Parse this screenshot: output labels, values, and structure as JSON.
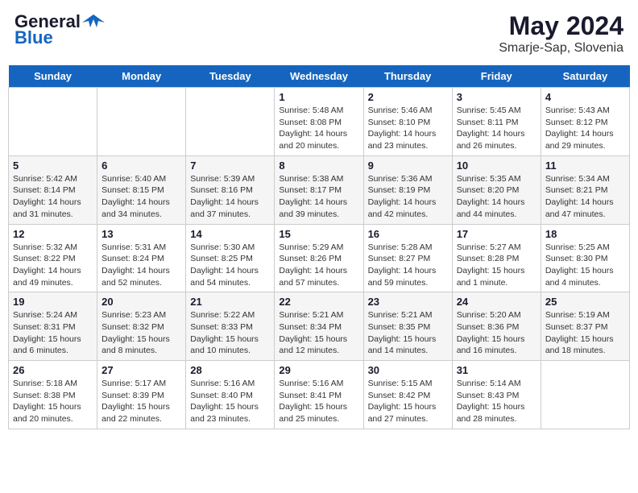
{
  "header": {
    "logo_line1": "General",
    "logo_line2": "Blue",
    "month": "May 2024",
    "location": "Smarje-Sap, Slovenia"
  },
  "days_of_week": [
    "Sunday",
    "Monday",
    "Tuesday",
    "Wednesday",
    "Thursday",
    "Friday",
    "Saturday"
  ],
  "weeks": [
    [
      {
        "day": "",
        "info": ""
      },
      {
        "day": "",
        "info": ""
      },
      {
        "day": "",
        "info": ""
      },
      {
        "day": "1",
        "info": "Sunrise: 5:48 AM\nSunset: 8:08 PM\nDaylight: 14 hours\nand 20 minutes."
      },
      {
        "day": "2",
        "info": "Sunrise: 5:46 AM\nSunset: 8:10 PM\nDaylight: 14 hours\nand 23 minutes."
      },
      {
        "day": "3",
        "info": "Sunrise: 5:45 AM\nSunset: 8:11 PM\nDaylight: 14 hours\nand 26 minutes."
      },
      {
        "day": "4",
        "info": "Sunrise: 5:43 AM\nSunset: 8:12 PM\nDaylight: 14 hours\nand 29 minutes."
      }
    ],
    [
      {
        "day": "5",
        "info": "Sunrise: 5:42 AM\nSunset: 8:14 PM\nDaylight: 14 hours\nand 31 minutes."
      },
      {
        "day": "6",
        "info": "Sunrise: 5:40 AM\nSunset: 8:15 PM\nDaylight: 14 hours\nand 34 minutes."
      },
      {
        "day": "7",
        "info": "Sunrise: 5:39 AM\nSunset: 8:16 PM\nDaylight: 14 hours\nand 37 minutes."
      },
      {
        "day": "8",
        "info": "Sunrise: 5:38 AM\nSunset: 8:17 PM\nDaylight: 14 hours\nand 39 minutes."
      },
      {
        "day": "9",
        "info": "Sunrise: 5:36 AM\nSunset: 8:19 PM\nDaylight: 14 hours\nand 42 minutes."
      },
      {
        "day": "10",
        "info": "Sunrise: 5:35 AM\nSunset: 8:20 PM\nDaylight: 14 hours\nand 44 minutes."
      },
      {
        "day": "11",
        "info": "Sunrise: 5:34 AM\nSunset: 8:21 PM\nDaylight: 14 hours\nand 47 minutes."
      }
    ],
    [
      {
        "day": "12",
        "info": "Sunrise: 5:32 AM\nSunset: 8:22 PM\nDaylight: 14 hours\nand 49 minutes."
      },
      {
        "day": "13",
        "info": "Sunrise: 5:31 AM\nSunset: 8:24 PM\nDaylight: 14 hours\nand 52 minutes."
      },
      {
        "day": "14",
        "info": "Sunrise: 5:30 AM\nSunset: 8:25 PM\nDaylight: 14 hours\nand 54 minutes."
      },
      {
        "day": "15",
        "info": "Sunrise: 5:29 AM\nSunset: 8:26 PM\nDaylight: 14 hours\nand 57 minutes."
      },
      {
        "day": "16",
        "info": "Sunrise: 5:28 AM\nSunset: 8:27 PM\nDaylight: 14 hours\nand 59 minutes."
      },
      {
        "day": "17",
        "info": "Sunrise: 5:27 AM\nSunset: 8:28 PM\nDaylight: 15 hours\nand 1 minute."
      },
      {
        "day": "18",
        "info": "Sunrise: 5:25 AM\nSunset: 8:30 PM\nDaylight: 15 hours\nand 4 minutes."
      }
    ],
    [
      {
        "day": "19",
        "info": "Sunrise: 5:24 AM\nSunset: 8:31 PM\nDaylight: 15 hours\nand 6 minutes."
      },
      {
        "day": "20",
        "info": "Sunrise: 5:23 AM\nSunset: 8:32 PM\nDaylight: 15 hours\nand 8 minutes."
      },
      {
        "day": "21",
        "info": "Sunrise: 5:22 AM\nSunset: 8:33 PM\nDaylight: 15 hours\nand 10 minutes."
      },
      {
        "day": "22",
        "info": "Sunrise: 5:21 AM\nSunset: 8:34 PM\nDaylight: 15 hours\nand 12 minutes."
      },
      {
        "day": "23",
        "info": "Sunrise: 5:21 AM\nSunset: 8:35 PM\nDaylight: 15 hours\nand 14 minutes."
      },
      {
        "day": "24",
        "info": "Sunrise: 5:20 AM\nSunset: 8:36 PM\nDaylight: 15 hours\nand 16 minutes."
      },
      {
        "day": "25",
        "info": "Sunrise: 5:19 AM\nSunset: 8:37 PM\nDaylight: 15 hours\nand 18 minutes."
      }
    ],
    [
      {
        "day": "26",
        "info": "Sunrise: 5:18 AM\nSunset: 8:38 PM\nDaylight: 15 hours\nand 20 minutes."
      },
      {
        "day": "27",
        "info": "Sunrise: 5:17 AM\nSunset: 8:39 PM\nDaylight: 15 hours\nand 22 minutes."
      },
      {
        "day": "28",
        "info": "Sunrise: 5:16 AM\nSunset: 8:40 PM\nDaylight: 15 hours\nand 23 minutes."
      },
      {
        "day": "29",
        "info": "Sunrise: 5:16 AM\nSunset: 8:41 PM\nDaylight: 15 hours\nand 25 minutes."
      },
      {
        "day": "30",
        "info": "Sunrise: 5:15 AM\nSunset: 8:42 PM\nDaylight: 15 hours\nand 27 minutes."
      },
      {
        "day": "31",
        "info": "Sunrise: 5:14 AM\nSunset: 8:43 PM\nDaylight: 15 hours\nand 28 minutes."
      },
      {
        "day": "",
        "info": ""
      }
    ]
  ]
}
